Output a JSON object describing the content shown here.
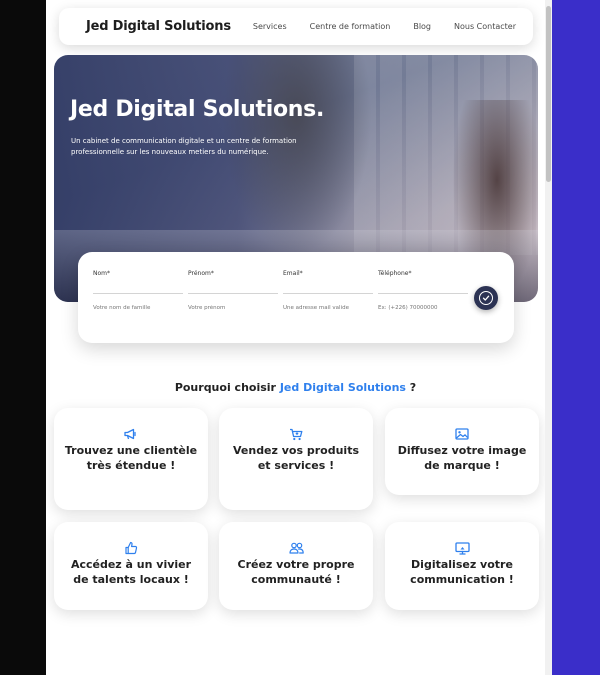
{
  "header": {
    "brand": "Jed Digital Solutions",
    "nav": [
      "Services",
      "Centre de formation",
      "Blog",
      "Nous Contacter"
    ]
  },
  "hero": {
    "title": "Jed Digital Solutions.",
    "subtitle": "Un cabinet de communication digitale et un centre de formation professionnelle sur les nouveaux metiers du numérique."
  },
  "form": {
    "fields": [
      {
        "label": "Nom*",
        "placeholder": "Votre nom de famille"
      },
      {
        "label": "Prénom*",
        "placeholder": "Votre prénom"
      },
      {
        "label": "Email*",
        "placeholder": "Une adresse mail valide"
      },
      {
        "label": "Téléphone*",
        "placeholder": "Ex: (+226) 70000000"
      }
    ]
  },
  "why": {
    "prefix": "Pourquoi choisir ",
    "highlight": "Jed Digital Solutions",
    "suffix": " ?"
  },
  "features": [
    {
      "text": "Trouvez une clientèle très étendue !",
      "icon": "megaphone-icon"
    },
    {
      "text": "Vendez vos produits et services !",
      "icon": "cart-icon"
    },
    {
      "text": "Diffusez votre image de marque !",
      "icon": "image-icon"
    },
    {
      "text": "Accédez à un vivier de talents locaux !",
      "icon": "thumbs-up-icon"
    },
    {
      "text": "Créez votre propre communauté !",
      "icon": "community-icon"
    },
    {
      "text": "Digitalisez votre communication !",
      "icon": "screen-icon"
    }
  ],
  "colors": {
    "accent": "#2f80ed",
    "submit": "#2c3354",
    "right_panel": "#3a2ec9"
  }
}
